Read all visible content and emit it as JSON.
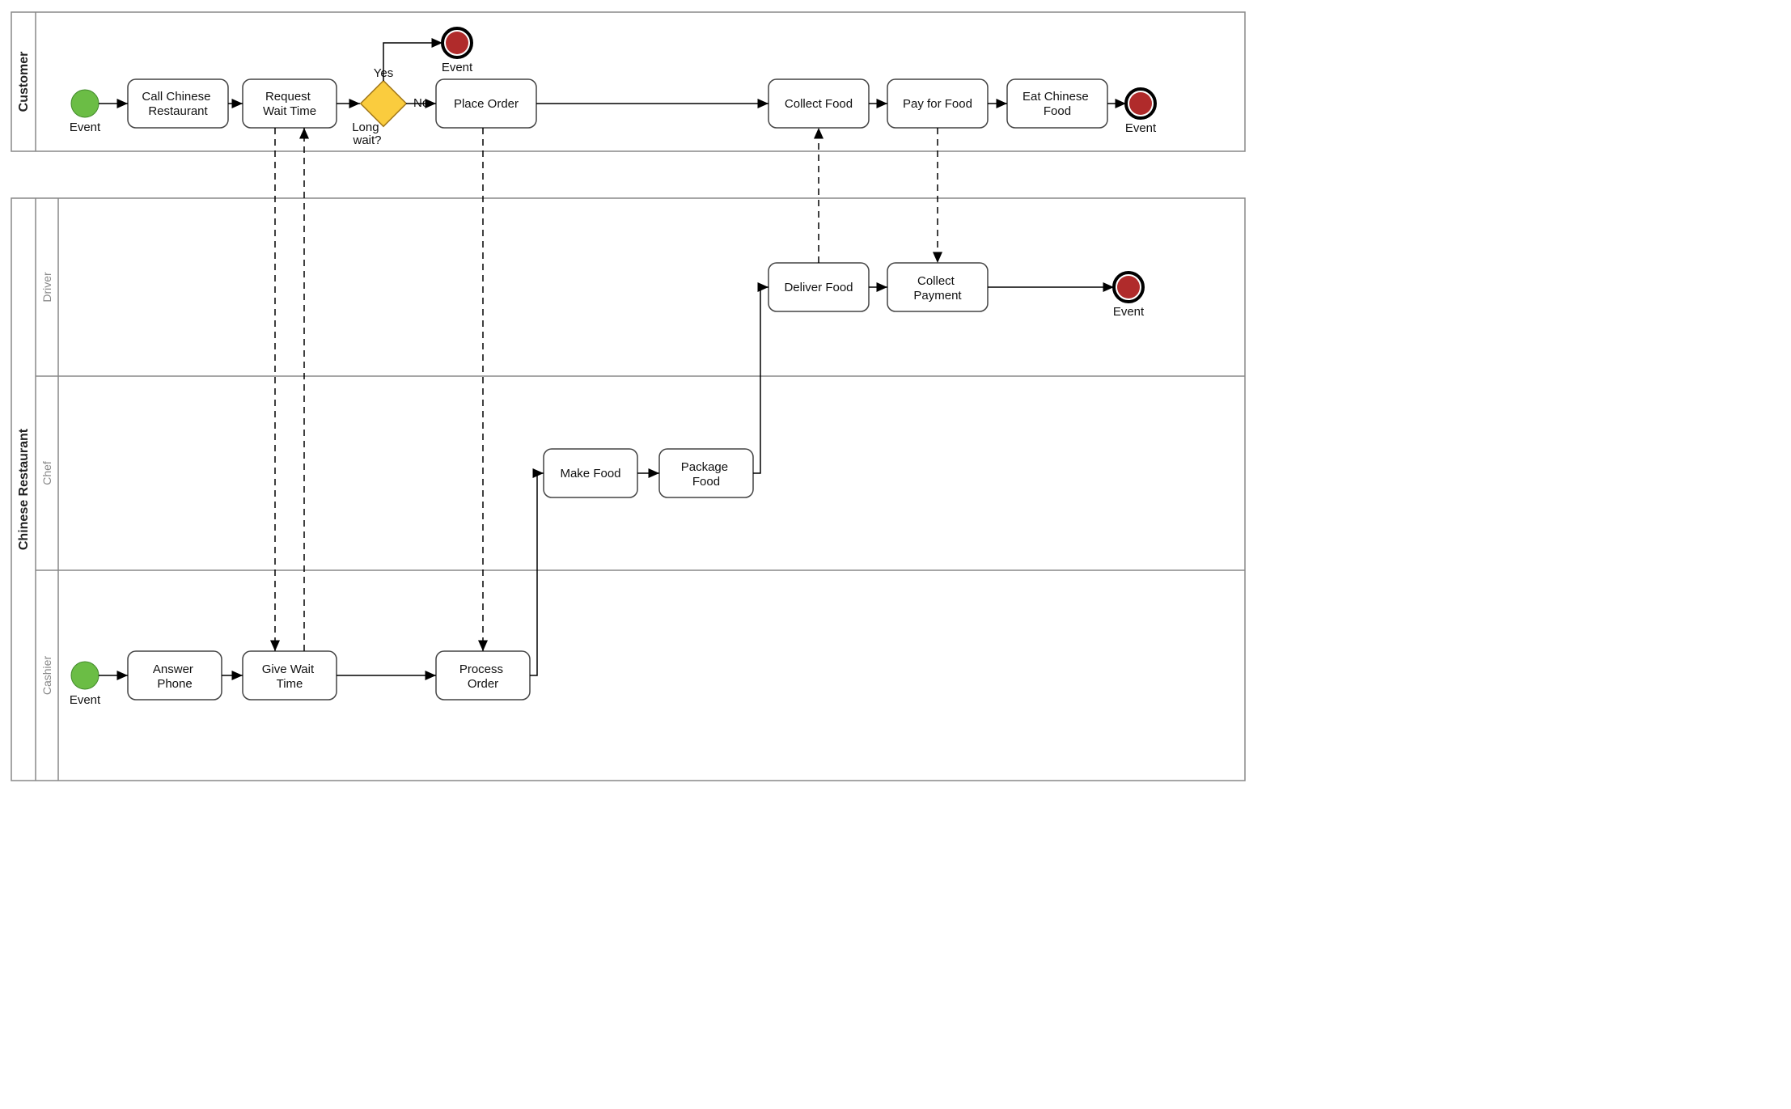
{
  "pools": {
    "customer": {
      "title": "Customer"
    },
    "restaurant": {
      "title": "Chinese Restaurant"
    }
  },
  "lanes": {
    "driver": {
      "title": "Driver"
    },
    "chef": {
      "title": "Chef"
    },
    "cashier": {
      "title": "Cashier"
    }
  },
  "events": {
    "start_customer": {
      "label": "Event"
    },
    "end_customer_long": {
      "label": "Event"
    },
    "end_customer": {
      "label": "Event"
    },
    "end_driver": {
      "label": "Event"
    },
    "start_cashier": {
      "label": "Event"
    }
  },
  "tasks": {
    "call": "Call Chinese Restaurant",
    "request": "Request Wait Time",
    "place": "Place Order",
    "collect": "Collect Food",
    "pay": "Pay for Food",
    "eat": "Eat Chinese Food",
    "deliver": "Deliver Food",
    "collectpay": "Collect Payment",
    "makefood": "Make Food",
    "package": "Package Food",
    "answer": "Answer Phone",
    "givewait": "Give Wait Time",
    "process": "Process Order"
  },
  "gateway": {
    "longwait": {
      "label": "Long wait?",
      "yes": "Yes",
      "no": "No"
    }
  },
  "colors": {
    "start": "#6bbd45",
    "end": "#b02b2b",
    "gateway": "#facc3e"
  }
}
